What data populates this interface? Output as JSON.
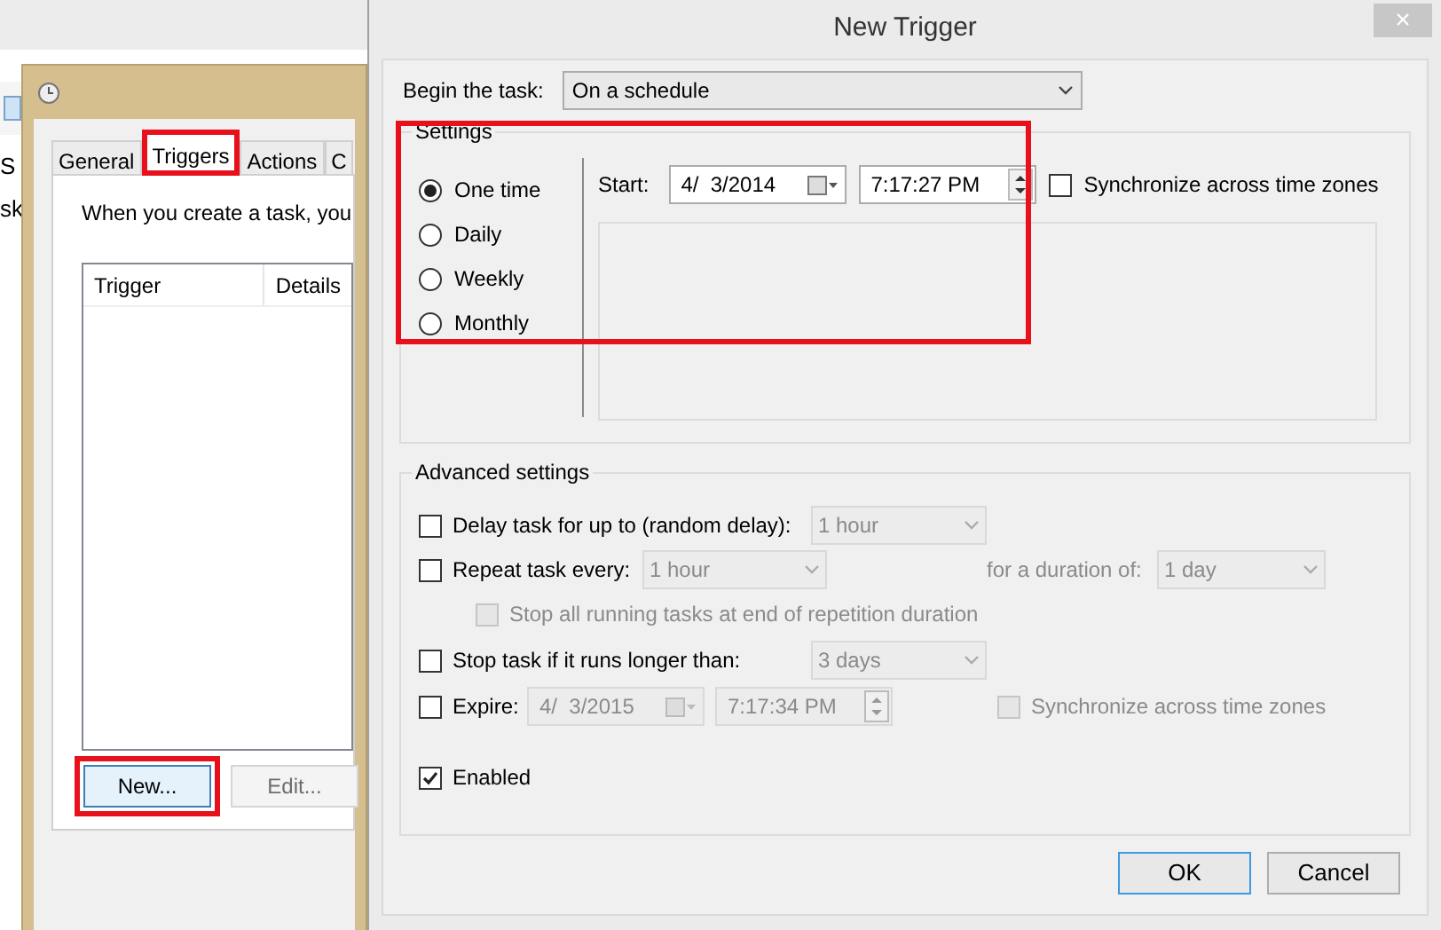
{
  "background_app": {
    "left_pane": [
      "S",
      "sk"
    ]
  },
  "task_dialog": {
    "tabs": [
      {
        "label": "General",
        "selected": false,
        "highlighted": false
      },
      {
        "label": "Triggers",
        "selected": true,
        "highlighted": true
      },
      {
        "label": "Actions",
        "selected": false,
        "highlighted": false
      },
      {
        "label": "C",
        "selected": false,
        "highlighted": false
      }
    ],
    "description": "When you create a task, you",
    "columns": [
      "Trigger",
      "Details"
    ],
    "buttons": [
      {
        "label": "New...",
        "disabled": false,
        "highlighted": true
      },
      {
        "label": "Edit...",
        "disabled": true,
        "highlighted": false
      }
    ]
  },
  "new_trigger": {
    "title": "New Trigger",
    "close": "×",
    "begin_label": "Begin the task:",
    "begin_value": "On a schedule",
    "settings": {
      "legend": "Settings",
      "highlighted": true,
      "schedule_options": [
        {
          "label": "One time",
          "selected": true
        },
        {
          "label": "Daily",
          "selected": false
        },
        {
          "label": "Weekly",
          "selected": false
        },
        {
          "label": "Monthly",
          "selected": false
        }
      ],
      "start_label": "Start:",
      "start_date": "4/  3/2014",
      "start_time": "7:17:27 PM",
      "sync": {
        "label": "Synchronize across time zones",
        "checked": false
      }
    },
    "advanced": {
      "legend": "Advanced settings",
      "delay": {
        "label": "Delay task for up to (random delay):",
        "checked": false,
        "value": "1 hour"
      },
      "repeat": {
        "label": "Repeat task every:",
        "checked": false,
        "value": "1 hour",
        "duration_label": "for a duration of:",
        "duration_value": "1 day"
      },
      "stop_all": {
        "label": "Stop all running tasks at end of repetition duration",
        "checked": false
      },
      "stop_task": {
        "label": "Stop task if it runs longer than:",
        "checked": false,
        "value": "3 days"
      },
      "expire": {
        "label": "Expire:",
        "checked": false,
        "date": "4/  3/2015",
        "time": "7:17:34 PM",
        "sync": {
          "label": "Synchronize across time zones",
          "checked": false
        }
      },
      "enabled": {
        "label": "Enabled",
        "checked": true
      }
    },
    "buttons": [
      {
        "label": "OK",
        "default": true
      },
      {
        "label": "Cancel",
        "default": false
      }
    ]
  }
}
